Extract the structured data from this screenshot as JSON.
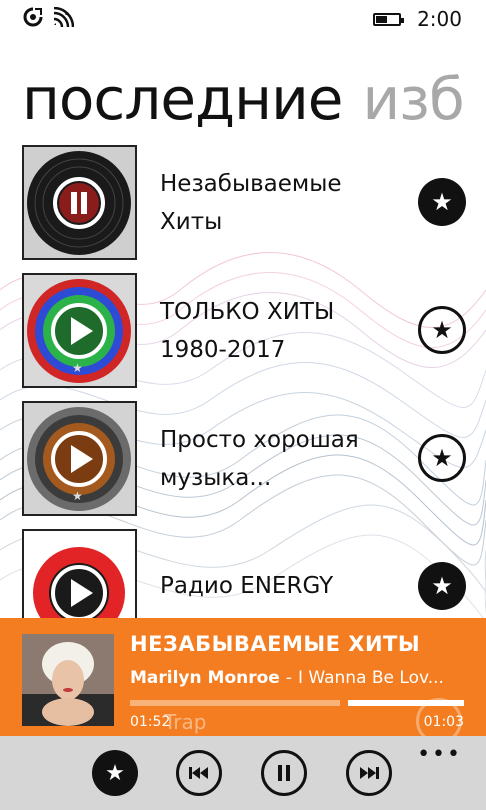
{
  "status_bar": {
    "time": "2:00",
    "battery_level": 0.55,
    "icons": [
      "notification-icon",
      "wifi-icon",
      "battery-icon"
    ]
  },
  "pivot": {
    "tabs": [
      {
        "label": "последние",
        "active": true
      },
      {
        "label": "изб",
        "active": false
      }
    ]
  },
  "stations": [
    {
      "title": "Незабываемые Хиты",
      "favorite": true,
      "thumb_icon": "vinyl-pause-icon"
    },
    {
      "title": "ТОЛЬКО ХИТЫ 1980-2017",
      "favorite": false,
      "thumb_icon": "speaker-play-icon"
    },
    {
      "title": "Просто хорошая музыка...",
      "favorite": false,
      "thumb_icon": "speaker-play-icon"
    },
    {
      "title": "Радио ENERGY",
      "favorite": true,
      "thumb_icon": "energy-logo-play-icon"
    }
  ],
  "now_playing": {
    "station": "НЕЗАБЫВАЕМЫЕ ХИТЫ",
    "artist": "Marilyn Monroe",
    "separator": "-",
    "song": "I Wanna Be Lov...",
    "elapsed": "01:52",
    "total": "01:03",
    "progress": 0.64,
    "partially_hidden_item": "Trap"
  },
  "app_bar": {
    "buttons": [
      "favorite-star-icon",
      "previous-icon",
      "pause-icon",
      "next-icon"
    ],
    "more_label": "•••"
  },
  "colors": {
    "accent": "#f37d20",
    "app_bar_bg": "#d6d6d6",
    "inactive_tab": "#a8a8a8"
  }
}
